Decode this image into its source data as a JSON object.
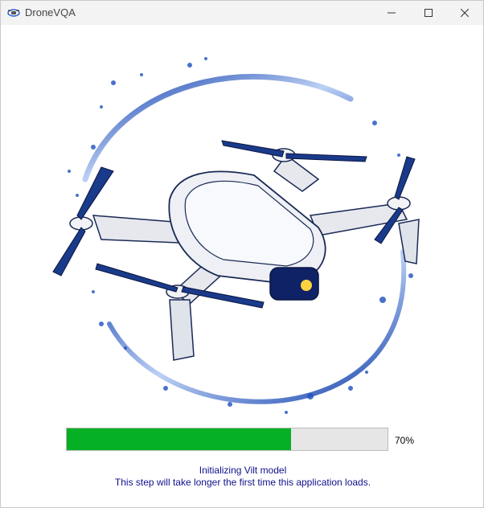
{
  "window": {
    "title": "DroneVQA",
    "app_icon": "drone-app-icon",
    "controls": [
      "minimize-icon",
      "maximize-icon",
      "close-icon"
    ]
  },
  "splash": {
    "image": "drone-illustration",
    "accent_color": "#1a3fa0"
  },
  "progress": {
    "value": 0.7,
    "label": "70%",
    "fill_color": "#06b025"
  },
  "status": {
    "line1": "Initializing Vilt model",
    "line2": "This step will take longer the first time this application loads."
  }
}
